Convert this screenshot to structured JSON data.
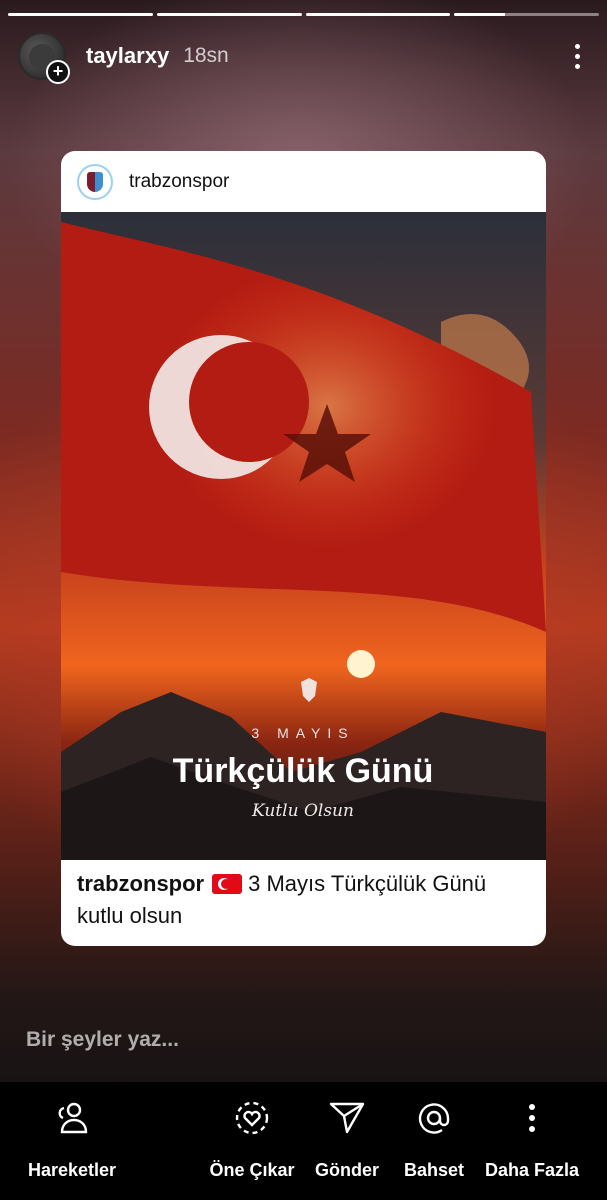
{
  "story": {
    "progress_segments": [
      1,
      1,
      1,
      1
    ],
    "username": "taylarxy",
    "time": "18sn",
    "more_icon": "more-vertical-icon",
    "add_badge": "+"
  },
  "post": {
    "username": "trabzonspor",
    "image_text": {
      "date": "3 MAYIS",
      "headline": "Türkçülük Günü",
      "script": "Kutlu Olsun"
    },
    "caption": {
      "username": "trabzonspor",
      "emoji": "turkey-flag-icon",
      "text": "3 Mayıs Türkçülük Günü kutlu olsun"
    }
  },
  "reply": {
    "placeholder": "Bir şeyler yaz..."
  },
  "bottom_actions": [
    {
      "label": "Hareketler",
      "icon": "activity-icon"
    },
    {
      "label": "Öne Çıkar",
      "icon": "highlight-icon"
    },
    {
      "label": "Gönder",
      "icon": "send-icon"
    },
    {
      "label": "Bahset",
      "icon": "mention-icon"
    },
    {
      "label": "Daha Fazla",
      "icon": "more-vertical-icon"
    }
  ],
  "colors": {
    "flag_red": "#e30a17",
    "card_bg": "#ffffff",
    "bottom_bar_bg": "#000000"
  }
}
